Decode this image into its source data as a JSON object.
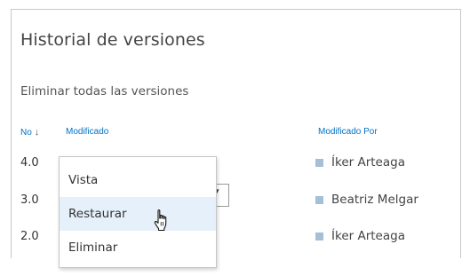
{
  "dialog": {
    "title": "Historial de versiones",
    "delete_all_label": "Eliminar todas las versiones"
  },
  "table": {
    "columns": {
      "no": "No",
      "sort_arrow": "🠗",
      "modified": "Modificado",
      "modified_by": "Modificado Por"
    },
    "rows": [
      {
        "version": "4.0",
        "modified_by": "Íker Arteaga"
      },
      {
        "version": "3.0",
        "modified_by": "Beatriz Melgar"
      },
      {
        "version": "2.0",
        "modified_by": "Íker Arteaga"
      }
    ]
  },
  "context_menu": {
    "items": [
      {
        "label": "Vista"
      },
      {
        "label": "Restaurar",
        "hovered": true
      },
      {
        "label": "Eliminar"
      }
    ]
  },
  "colors": {
    "link": "#0072c6",
    "user_square": "#a4bfd6",
    "hover_bg": "#e6f0fa"
  },
  "icons": {
    "sort": "arrow-down-icon",
    "cursor": "hand-pointer-icon",
    "dropdown": "chevron-down-icon"
  }
}
